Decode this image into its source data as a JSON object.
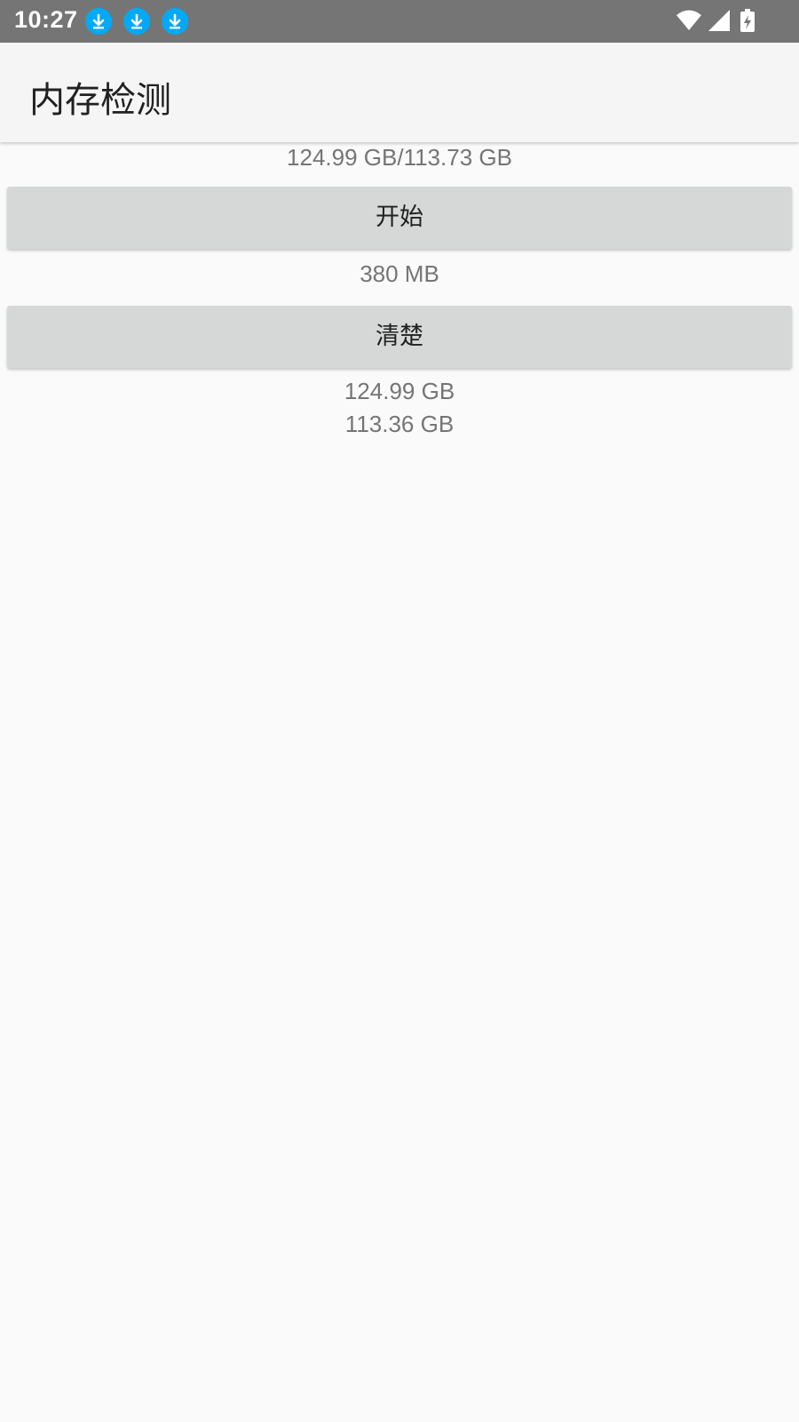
{
  "status_bar": {
    "time": "10:27",
    "notification_icons": [
      "download-icon",
      "download-icon",
      "download-icon"
    ],
    "system_icons": [
      "wifi-icon",
      "signal-icon",
      "battery-charging-icon"
    ],
    "background_color": "#757575",
    "notification_color": "#03a9f4"
  },
  "app_bar": {
    "title": "内存检测"
  },
  "main": {
    "storage_summary": "124.99 GB/113.73 GB",
    "start_button_label": "开始",
    "memory_value": "380 MB",
    "clear_button_label": "清楚",
    "total_storage": "124.99 GB",
    "available_storage": "113.36 GB"
  }
}
